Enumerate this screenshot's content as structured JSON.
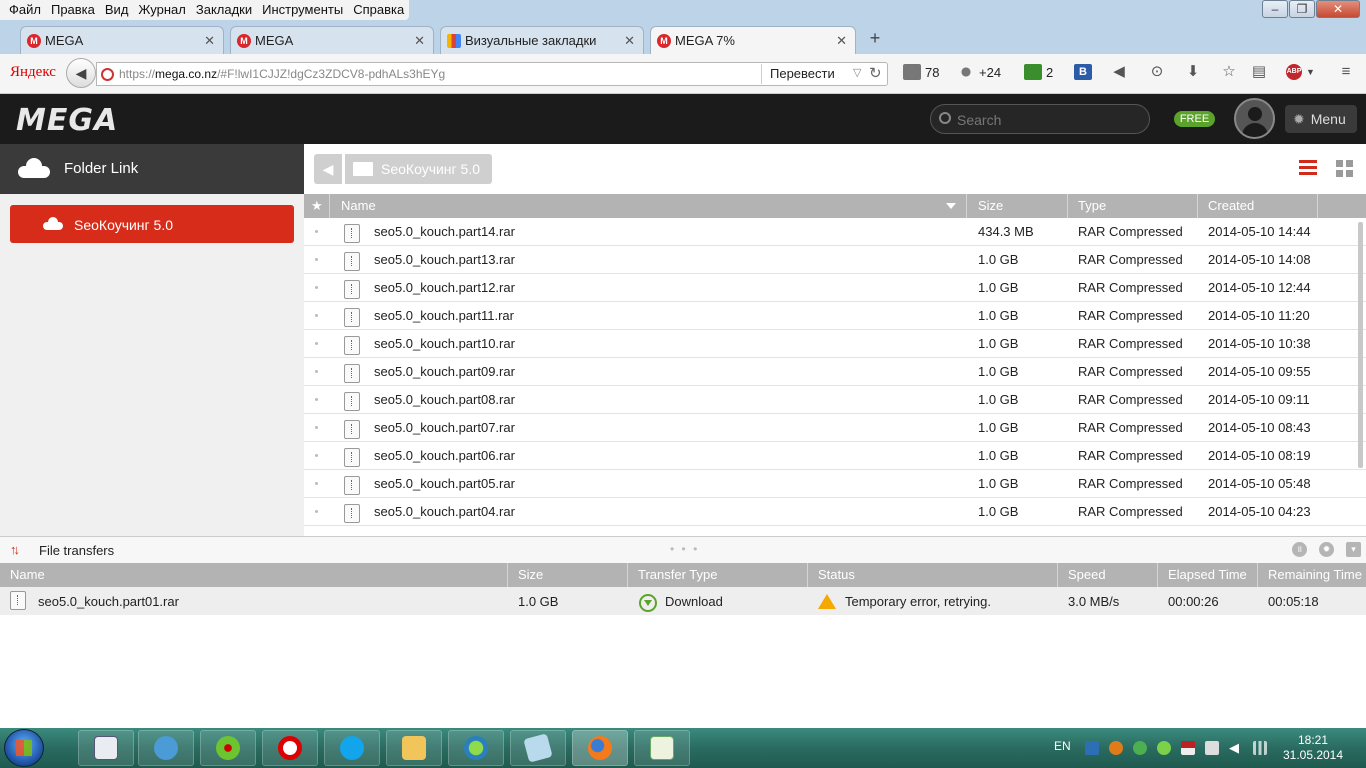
{
  "browser": {
    "menu": [
      "Файл",
      "Правка",
      "Вид",
      "Журнал",
      "Закладки",
      "Инструменты",
      "Справка"
    ],
    "tabs": [
      {
        "title": "MEGA",
        "favicon": "mega-icon"
      },
      {
        "title": "MEGA",
        "favicon": "mega-icon"
      },
      {
        "title": "Визуальные закладки",
        "favicon": "visual-bookmarks-icon"
      },
      {
        "title": "MEGA 7%",
        "favicon": "mega-icon",
        "active": true
      }
    ],
    "yandex_label": "Яндекс",
    "url_host": "mega.co.nz",
    "url_prefix": "https://",
    "url_path": "/#F!lwI1CJJZ!dgCz3ZDCV8-pdhALs3hEYg",
    "translate_label": "Перевести",
    "extensions": {
      "mail_count": "78",
      "weather": "+24",
      "counter": "2"
    }
  },
  "mega": {
    "logo": "MEGA",
    "search_placeholder": "Search",
    "free_badge": "FREE",
    "menu_label": "Menu",
    "folder_link_label": "Folder Link",
    "tree_item": "SeoКоучинг 5.0",
    "breadcrumb_folder": "SeoКоучинг 5.0",
    "accent_color": "#d82c1a"
  },
  "files": {
    "columns": {
      "name": "Name",
      "size": "Size",
      "type": "Type",
      "created": "Created"
    },
    "rows": [
      {
        "name": "seo5.0_kouch.part14.rar",
        "size": "434.3 MB",
        "type": "RAR Compressed",
        "created": "2014-05-10 14:44"
      },
      {
        "name": "seo5.0_kouch.part13.rar",
        "size": "1.0 GB",
        "type": "RAR Compressed",
        "created": "2014-05-10 14:08"
      },
      {
        "name": "seo5.0_kouch.part12.rar",
        "size": "1.0 GB",
        "type": "RAR Compressed",
        "created": "2014-05-10 12:44"
      },
      {
        "name": "seo5.0_kouch.part11.rar",
        "size": "1.0 GB",
        "type": "RAR Compressed",
        "created": "2014-05-10 11:20"
      },
      {
        "name": "seo5.0_kouch.part10.rar",
        "size": "1.0 GB",
        "type": "RAR Compressed",
        "created": "2014-05-10 10:38"
      },
      {
        "name": "seo5.0_kouch.part09.rar",
        "size": "1.0 GB",
        "type": "RAR Compressed",
        "created": "2014-05-10 09:55"
      },
      {
        "name": "seo5.0_kouch.part08.rar",
        "size": "1.0 GB",
        "type": "RAR Compressed",
        "created": "2014-05-10 09:11"
      },
      {
        "name": "seo5.0_kouch.part07.rar",
        "size": "1.0 GB",
        "type": "RAR Compressed",
        "created": "2014-05-10 08:43"
      },
      {
        "name": "seo5.0_kouch.part06.rar",
        "size": "1.0 GB",
        "type": "RAR Compressed",
        "created": "2014-05-10 08:19"
      },
      {
        "name": "seo5.0_kouch.part05.rar",
        "size": "1.0 GB",
        "type": "RAR Compressed",
        "created": "2014-05-10 05:48"
      },
      {
        "name": "seo5.0_kouch.part04.rar",
        "size": "1.0 GB",
        "type": "RAR Compressed",
        "created": "2014-05-10 04:23"
      }
    ]
  },
  "transfers": {
    "title": "File transfers",
    "columns": {
      "name": "Name",
      "size": "Size",
      "transfer_type": "Transfer Type",
      "status": "Status",
      "speed": "Speed",
      "elapsed": "Elapsed Time",
      "remaining": "Remaining Time"
    },
    "row": {
      "name": "seo5.0_kouch.part01.rar",
      "size": "1.0 GB",
      "transfer_type": "Download",
      "status": "Temporary error, retrying.",
      "speed": "3.0 MB/s",
      "elapsed": "00:00:26",
      "remaining": "00:05:18"
    }
  },
  "taskbar": {
    "language": "EN",
    "time": "18:21",
    "date": "31.05.2014"
  }
}
